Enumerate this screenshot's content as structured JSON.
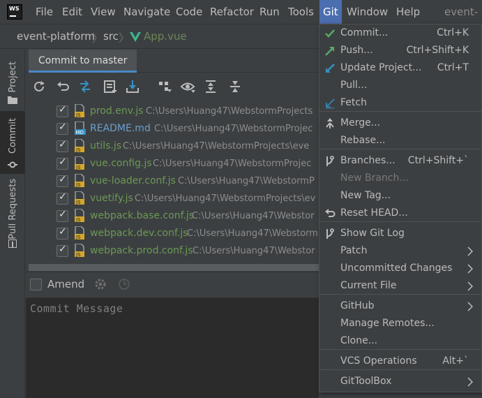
{
  "app": {
    "logo_text": "WS",
    "window_title": "event-pl"
  },
  "menubar": {
    "items": [
      "File",
      "Edit",
      "View",
      "Navigate",
      "Code",
      "Refactor",
      "Run",
      "Tools",
      "Git",
      "Window",
      "Help"
    ],
    "active": "Git"
  },
  "breadcrumb": {
    "project": "event-platform",
    "folder": "src",
    "file": "App.vue"
  },
  "toolstrip": {
    "project_label": "Project",
    "commit_label": "Commit",
    "pull_requests_label": "Pull Requests"
  },
  "commit_panel": {
    "tab_label": "Commit to master",
    "files": [
      {
        "name": "prod.env.js",
        "type": "js",
        "path": "C:\\Users\\Huang47\\WebstormProjects"
      },
      {
        "name": "README.md",
        "type": "md",
        "path": "C:\\Users\\Huang47\\WebstormProjec"
      },
      {
        "name": "utils.js",
        "type": "js",
        "path": "C:\\Users\\Huang47\\WebstormProjects\\eve"
      },
      {
        "name": "vue.config.js",
        "type": "js",
        "path": "C:\\Users\\Huang47\\WebstormProjec"
      },
      {
        "name": "vue-loader.conf.js",
        "type": "js",
        "path": "C:\\Users\\Huang47\\WebstormP"
      },
      {
        "name": "vuetify.js",
        "type": "js",
        "path": "C:\\Users\\Huang47\\WebstormProjects\\ev"
      },
      {
        "name": "webpack.base.conf.js",
        "type": "js",
        "path": "C:\\Users\\Huang47\\Webstor"
      },
      {
        "name": "webpack.dev.conf.js",
        "type": "js",
        "path": "C:\\Users\\Huang47\\Webstorm"
      },
      {
        "name": "webpack.prod.conf.js",
        "type": "js",
        "path": "C:\\Users\\Huang47\\Webstor"
      }
    ],
    "amend_label": "Amend",
    "message_placeholder": "Commit Message"
  },
  "git_menu": {
    "items": [
      {
        "label": "Commit...",
        "shortcut": "Ctrl+K",
        "icon": "check-icon"
      },
      {
        "label": "Push...",
        "shortcut": "Ctrl+Shift+K",
        "icon": "push-arrow-icon"
      },
      {
        "label": "Update Project...",
        "shortcut": "Ctrl+T",
        "icon": "update-arrow-icon"
      },
      {
        "label": "Pull...",
        "shortcut": ""
      },
      {
        "label": "Fetch",
        "shortcut": "",
        "icon": "fetch-arrow-icon"
      },
      {
        "label": "Merge...",
        "shortcut": "",
        "icon": "merge-icon"
      },
      {
        "label": "Rebase...",
        "shortcut": ""
      },
      {
        "label": "Branches...",
        "shortcut": "Ctrl+Shift+`",
        "icon": "branch-icon"
      },
      {
        "label": "New Branch...",
        "shortcut": "",
        "disabled": true
      },
      {
        "label": "New Tag...",
        "shortcut": ""
      },
      {
        "label": "Reset HEAD...",
        "shortcut": "",
        "icon": "reset-icon"
      },
      {
        "label": "Show Git Log",
        "shortcut": "",
        "icon": "git-log-icon"
      },
      {
        "label": "Patch",
        "submenu": true
      },
      {
        "label": "Uncommitted Changes",
        "submenu": true
      },
      {
        "label": "Current File",
        "submenu": true
      },
      {
        "label": "GitHub",
        "submenu": true
      },
      {
        "label": "Manage Remotes...",
        "shortcut": ""
      },
      {
        "label": "Clone...",
        "shortcut": ""
      },
      {
        "label": "VCS Operations",
        "shortcut": "Alt+`"
      },
      {
        "label": "GitToolBox",
        "submenu": true
      }
    ]
  },
  "colors": {
    "accent": "#4b6eaf",
    "background": "#3c3f41",
    "editor_background": "#2b2b2b",
    "file_name_green": "#6a9955",
    "check_green": "#59a869",
    "blue_icon": "#3592c4"
  }
}
